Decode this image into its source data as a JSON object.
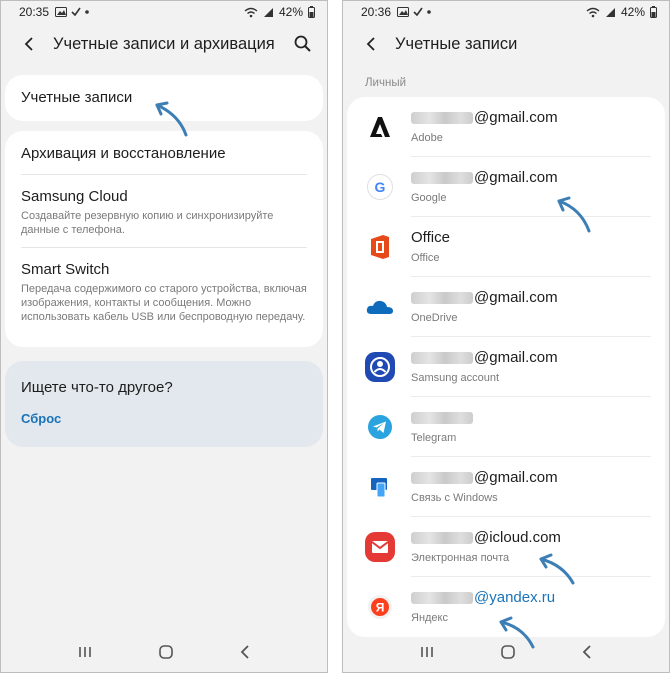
{
  "left": {
    "status": {
      "time": "20:35",
      "battery": "42%"
    },
    "toolbar": {
      "title": "Учетные записи и архивация"
    },
    "menu": {
      "accounts": "Учетные записи",
      "backup": "Архивация и восстановление",
      "cloud_title": "Samsung Cloud",
      "cloud_sub": "Создавайте резервную копию и синхронизируйте данные с телефона.",
      "switch_title": "Smart Switch",
      "switch_sub": "Передача содержимого со старого устройства, включая изображения, контакты и сообщения. Можно использовать кабель USB или беспроводную передачу."
    },
    "suggest": {
      "title": "Ищете что-то другое?",
      "link": "Сброс"
    }
  },
  "right": {
    "status": {
      "time": "20:36",
      "battery": "42%"
    },
    "toolbar": {
      "title": "Учетные записи"
    },
    "section": "Личный",
    "accounts": [
      {
        "name": "@gmail.com",
        "type": "Adobe",
        "icon": "adobe-icon",
        "masked": true
      },
      {
        "name": "@gmail.com",
        "type": "Google",
        "icon": "google-icon",
        "masked": true
      },
      {
        "name": "Office",
        "type": "Office",
        "icon": "office-icon",
        "masked": false
      },
      {
        "name": "@gmail.com",
        "type": "OneDrive",
        "icon": "onedrive-icon",
        "masked": true
      },
      {
        "name": "@gmail.com",
        "type": "Samsung account",
        "icon": "samsung-account-icon",
        "masked": true
      },
      {
        "name": "",
        "type": "Telegram",
        "icon": "telegram-icon",
        "masked": true
      },
      {
        "name": "@gmail.com",
        "type": "Связь с Windows",
        "icon": "windows-link-icon",
        "masked": true
      },
      {
        "name": "@icloud.com",
        "type": "Электронная почта",
        "icon": "email-icon",
        "masked": true
      },
      {
        "name": "@yandex.ru",
        "type": "Яндекс",
        "icon": "yandex-icon",
        "masked": true
      }
    ]
  },
  "colors": {
    "accent": "#1a73b8",
    "arrow": "#3d7fb5",
    "suggest_bg": "#e3e8ee"
  }
}
